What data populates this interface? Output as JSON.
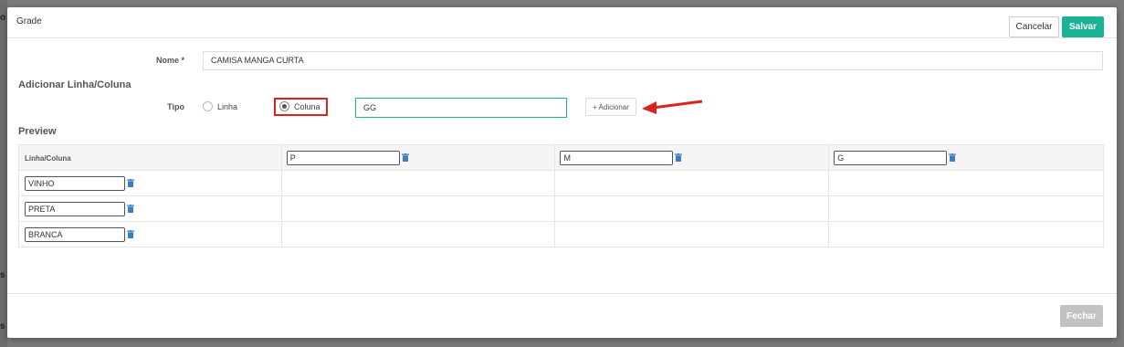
{
  "background": {
    "glyphs": [
      "o",
      "s",
      "s"
    ]
  },
  "modal": {
    "title": "Grade",
    "buttons": {
      "cancel": "Cancelar",
      "save": "Salvar",
      "close": "Fechar"
    }
  },
  "form": {
    "nome": {
      "label": "Nome *",
      "value": "CAMISA MANGA CURTA"
    },
    "add_section": {
      "title": "Adicionar Linha/Coluna",
      "tipo_label": "Tipo",
      "options": {
        "linha": "Linha",
        "coluna": "Coluna"
      },
      "selected": "Coluna",
      "input_value": "GG",
      "add_button": "+ Adicionar"
    }
  },
  "preview": {
    "title": "Preview",
    "header_label": "Linha/Coluna",
    "columns": [
      "P",
      "M",
      "G"
    ],
    "rows": [
      "VINHO",
      "PRETA",
      "BRANCA"
    ]
  },
  "colors": {
    "primary": "#1ab394",
    "annotation_red": "#d9231d",
    "trash_icon": "#3a7fc1",
    "disabled_button": "#c2c2c2"
  },
  "icons": {
    "trash": "trash-icon",
    "arrow": "arrow-annotation-icon"
  }
}
